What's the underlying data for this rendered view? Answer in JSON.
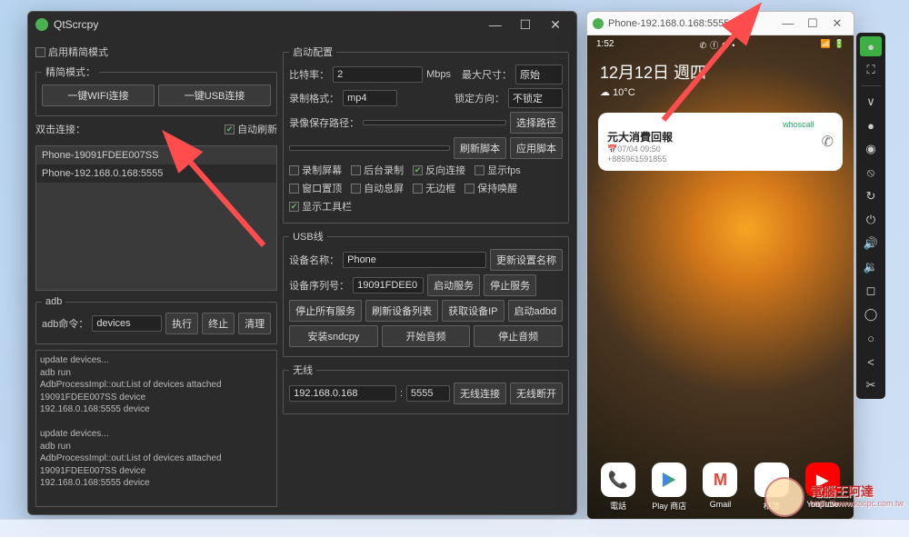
{
  "qt": {
    "title": "QtScrcpy",
    "simple_mode_check": "启用精简模式",
    "simple_mode_group": "精简模式：",
    "wifi_btn": "一键WIFI连接",
    "usb_btn": "一键USB连接",
    "dblclick": "双击连接：",
    "auto_refresh": "自动刷新",
    "devices": [
      "Phone-19091FDEE007SS",
      "Phone-192.168.0.168:5555"
    ],
    "adb_group": "adb",
    "adb_cmd_label": "adb命令：",
    "adb_cmd_value": "devices",
    "exec": "执行",
    "stop": "终止",
    "clear": "清理",
    "log": "update devices...\nadb run\nAdbProcessImpl::out:List of devices attached\n19091FDEE007SS          device\n192.168.0.168:5555      device\n\nupdate devices...\nadb run\nAdbProcessImpl::out:List of devices attached\n19091FDEE007SS          device\n192.168.0.168:5555      device",
    "start_cfg": "启动配置",
    "bitrate_lbl": "比特率：",
    "bitrate_val": "2",
    "bitrate_unit": "Mbps",
    "maxsize_lbl": "最大尺寸：",
    "maxsize_val": "原始",
    "recfmt_lbl": "录制格式：",
    "recfmt_val": "mp4",
    "lockdir_lbl": "锁定方向：",
    "lockdir_val": "不锁定",
    "recpath_lbl": "录像保存路径：",
    "recpath_btn": "选择路径",
    "refresh_script": "刷新脚本",
    "apply_script": "应用脚本",
    "chk_record": "录制屏幕",
    "chk_bgrec": "后台录制",
    "chk_reverse": "反向连接",
    "chk_fps": "显示fps",
    "chk_ontop": "窗口置顶",
    "chk_autooff": "自动息屏",
    "chk_noborder": "无边框",
    "chk_keepawake": "保持唤醒",
    "chk_toolbar": "显示工具栏",
    "usb_group": "USB线",
    "devname_lbl": "设备名称：",
    "devname_val": "Phone",
    "devname_upd": "更新设置名称",
    "serial_lbl": "设备序列号：",
    "serial_val": "19091FDEE0",
    "start_svc": "启动服务",
    "stop_svc": "停止服务",
    "stop_all": "停止所有服务",
    "refresh_dev": "刷新设备列表",
    "get_ip": "获取设备IP",
    "start_adbd": "启动adbd",
    "install_sndcpy": "安装sndcpy",
    "start_audio": "开始音频",
    "stop_audio": "停止音频",
    "wireless": "无线",
    "ip_val": "192.168.0.168",
    "port_val": "5555",
    "wl_conn": "无线连接",
    "wl_disc": "无线断开"
  },
  "phone": {
    "title": "Phone-192.168.0.168:5555",
    "time": "1:52",
    "date": "12月12日 週四",
    "temp": "10°C",
    "notif_brand": "whoscall",
    "notif_title": "元大消費回報",
    "notif_sub1": "📅07/04 09:50",
    "notif_sub2": "+885961591855",
    "apps": [
      {
        "label": "電話",
        "color": "#fff",
        "glyph": "📞"
      },
      {
        "label": "Play 商店",
        "color": "#fff",
        "glyph": "▶"
      },
      {
        "label": "Gmail",
        "color": "#fff",
        "glyph": "M"
      },
      {
        "label": "相簿",
        "color": "#fff",
        "glyph": "✦"
      },
      {
        "label": "YouTube",
        "color": "#f00",
        "glyph": "▶"
      }
    ]
  },
  "toolbar_icons": [
    "●",
    "⛶",
    "",
    "∨",
    "●",
    "◉",
    "⦸",
    "↻",
    "⏻",
    "🔊",
    "🔇",
    "◻",
    "◯",
    "○",
    "<",
    "✂"
  ],
  "watermark": {
    "text": "電腦王阿達",
    "url": "https://www.kocpc.com.tw"
  }
}
